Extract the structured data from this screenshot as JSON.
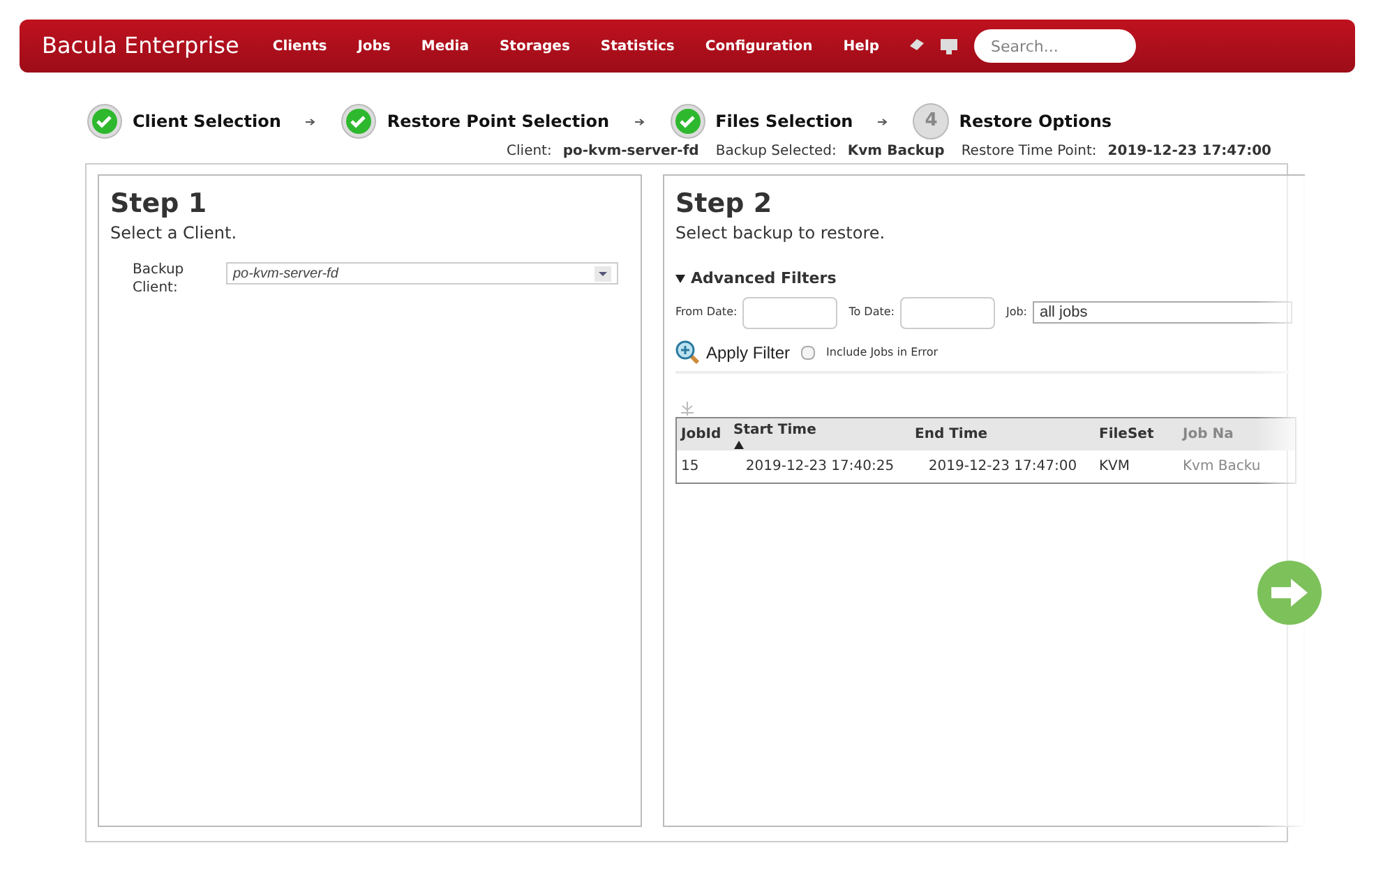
{
  "navbar": {
    "brand": "Bacula Enterprise",
    "menu": [
      "Clients",
      "Jobs",
      "Media",
      "Storages",
      "Statistics",
      "Configuration",
      "Help"
    ],
    "search": {
      "placeholder": "Search..."
    }
  },
  "steps": [
    {
      "label": "Client Selection",
      "completed": true
    },
    {
      "label": "Restore Point Selection",
      "completed": true
    },
    {
      "label": "Files Selection",
      "completed": true
    },
    {
      "label": "Restore Options",
      "completed": false,
      "number": "4"
    }
  ],
  "summary": [
    {
      "label": "Client:",
      "value": "po-kvm-server-fd"
    },
    {
      "label": "Backup Selected:",
      "value": "Kvm Backup"
    },
    {
      "label": "Restore Time Point:",
      "value": "2019-12-23 17:47:00"
    }
  ],
  "step1": {
    "title": "Step 1",
    "subtitle": "Select a Client.",
    "field_label": "Backup Client:",
    "client": "po-kvm-server-fd"
  },
  "step2": {
    "title": "Step 2",
    "subtitle": "Select backup to restore.",
    "filters": {
      "title": "Advanced Filters",
      "expanded": true,
      "from_label": "From Date:",
      "to_label": "To Date:",
      "job_label": "Job:",
      "job": "all jobs",
      "apply": "Apply Filter",
      "include_errors": {
        "label": "Include Jobs in Error",
        "checked": false
      }
    },
    "table": {
      "columns": [
        {
          "label": "JobId",
          "sorted": false
        },
        {
          "label": "Start Time",
          "sorted": true
        },
        {
          "label": "End Time",
          "sorted": false
        },
        {
          "label": "FileSet",
          "sorted": false
        },
        {
          "label": "Job Na",
          "sorted": false
        }
      ],
      "rows": [
        [
          "15",
          "2019-12-23 17:40:25",
          "2019-12-23 17:47:00",
          "KVM",
          "Kvm Backu"
        ]
      ]
    }
  }
}
